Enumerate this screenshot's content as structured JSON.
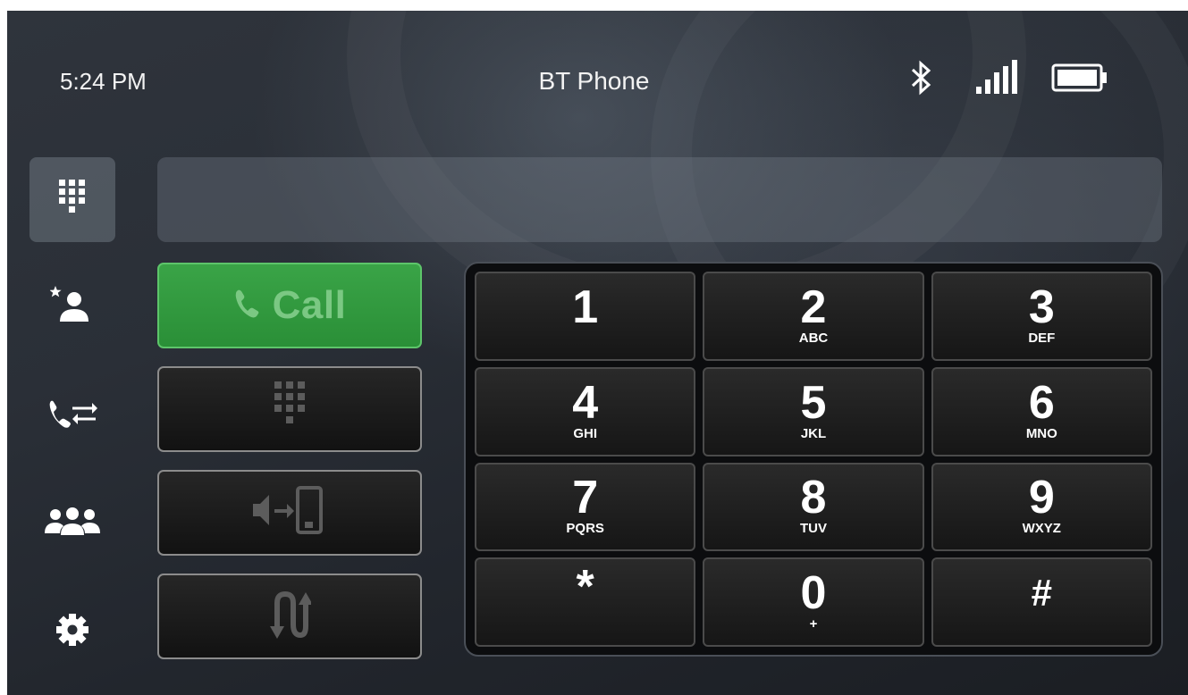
{
  "status_bar": {
    "time": "5:24 PM",
    "title": "BT Phone",
    "icons": [
      "bluetooth-icon",
      "signal-icon",
      "battery-icon"
    ]
  },
  "sidebar": {
    "items": [
      {
        "name": "keypad",
        "icon": "dialpad-icon",
        "active": true
      },
      {
        "name": "favorites",
        "icon": "favorite-contact-icon",
        "active": false
      },
      {
        "name": "recent-calls",
        "icon": "call-history-icon",
        "active": false
      },
      {
        "name": "contacts",
        "icon": "contacts-group-icon",
        "active": false
      },
      {
        "name": "settings",
        "icon": "gear-icon",
        "active": false
      }
    ]
  },
  "number_display": {
    "value": ""
  },
  "actions": {
    "call_label": "Call",
    "buttons": [
      "call-button",
      "dtmf-keypad-button",
      "transfer-audio-button",
      "switch-call-button"
    ]
  },
  "keypad": {
    "keys": [
      {
        "digit": "1",
        "letters": ""
      },
      {
        "digit": "2",
        "letters": "ABC"
      },
      {
        "digit": "3",
        "letters": "DEF"
      },
      {
        "digit": "4",
        "letters": "GHI"
      },
      {
        "digit": "5",
        "letters": "JKL"
      },
      {
        "digit": "6",
        "letters": "MNO"
      },
      {
        "digit": "7",
        "letters": "PQRS"
      },
      {
        "digit": "8",
        "letters": "TUV"
      },
      {
        "digit": "9",
        "letters": "WXYZ"
      },
      {
        "digit": "*",
        "letters": ""
      },
      {
        "digit": "0",
        "letters": "+"
      },
      {
        "digit": "#",
        "letters": ""
      }
    ]
  },
  "colors": {
    "call_green": "#2f9a3d",
    "call_text": "#7bc883",
    "key_bg": "#1e1e1e"
  }
}
